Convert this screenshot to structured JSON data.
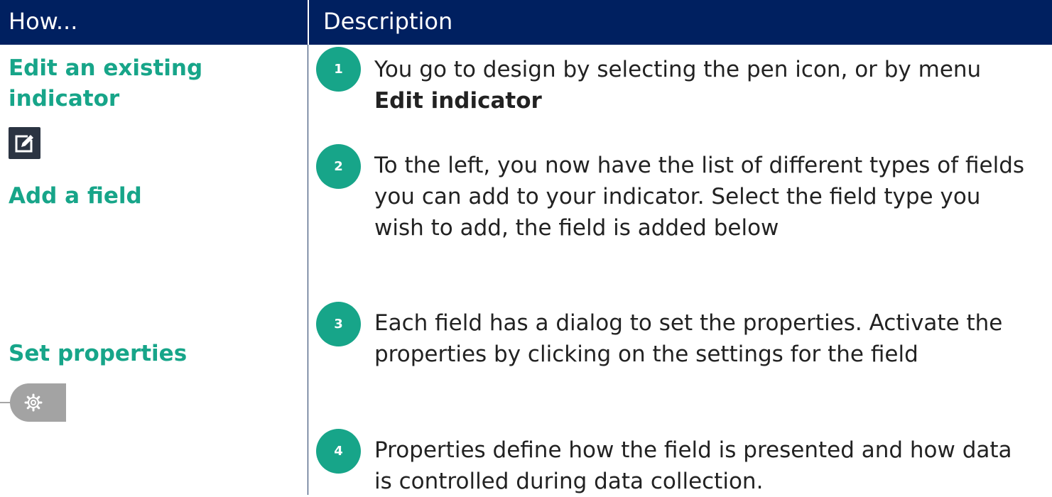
{
  "header": {
    "how": "How...",
    "description": "Description"
  },
  "left": {
    "edit_label": "Edit an existing indicator",
    "add_label": "Add a field",
    "set_label": "Set properties"
  },
  "steps": [
    {
      "number": "1",
      "text": "You go to design by selecting the pen icon, or by menu",
      "bold": "Edit indicator"
    },
    {
      "number": "2",
      "text": "To the left, you now have the list of different types of fields you can add to your indicator. Select the field type you wish to add, the field is added below"
    },
    {
      "number": "3",
      "text": "Each field has a dialog to set the properties. Activate the properties by clicking on the settings for the field"
    },
    {
      "number": "4",
      "text": "Properties define how the field is presented and how data is controlled during data collection."
    }
  ],
  "colors": {
    "header_bg": "#002060",
    "accent_green": "#17a589",
    "icon_dark": "#2b3442",
    "widget_gray": "#a3a3a3"
  },
  "icons": [
    "edit-pen-icon",
    "gear-icon"
  ]
}
